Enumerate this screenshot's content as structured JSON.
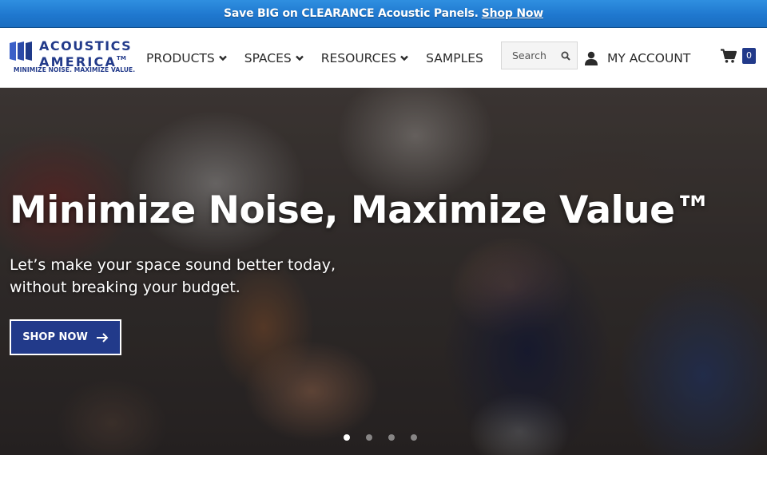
{
  "promo": {
    "text": "Save BIG on CLEARANCE Acoustic Panels.",
    "link": "Shop Now"
  },
  "logo": {
    "line1": "ACOUSTICS",
    "line2": "AMERICA",
    "tm": "TM",
    "tagline": "MINIMIZE NOISE. MAXIMIZE VALUE."
  },
  "nav": {
    "items": [
      {
        "label": "PRODUCTS",
        "has_dropdown": true
      },
      {
        "label": "SPACES",
        "has_dropdown": true
      },
      {
        "label": "RESOURCES",
        "has_dropdown": true
      },
      {
        "label": "SAMPLES",
        "has_dropdown": false
      }
    ]
  },
  "search": {
    "placeholder": "Search",
    "icon": "search-icon"
  },
  "account": {
    "label": "MY ACCOUNT",
    "icon": "user-icon"
  },
  "cart": {
    "count": "0",
    "icon": "cart-icon"
  },
  "hero": {
    "title": "Minimize Noise, Maximize Value™",
    "subtitle_line1": "Let’s make your space sound better today,",
    "subtitle_line2": "without breaking your budget.",
    "cta": "SHOP NOW",
    "slides": 4,
    "active_slide": 1
  },
  "colors": {
    "brand": "#223a8a",
    "promo_bar": "#1f78cf",
    "text": "#2b2b2b"
  }
}
